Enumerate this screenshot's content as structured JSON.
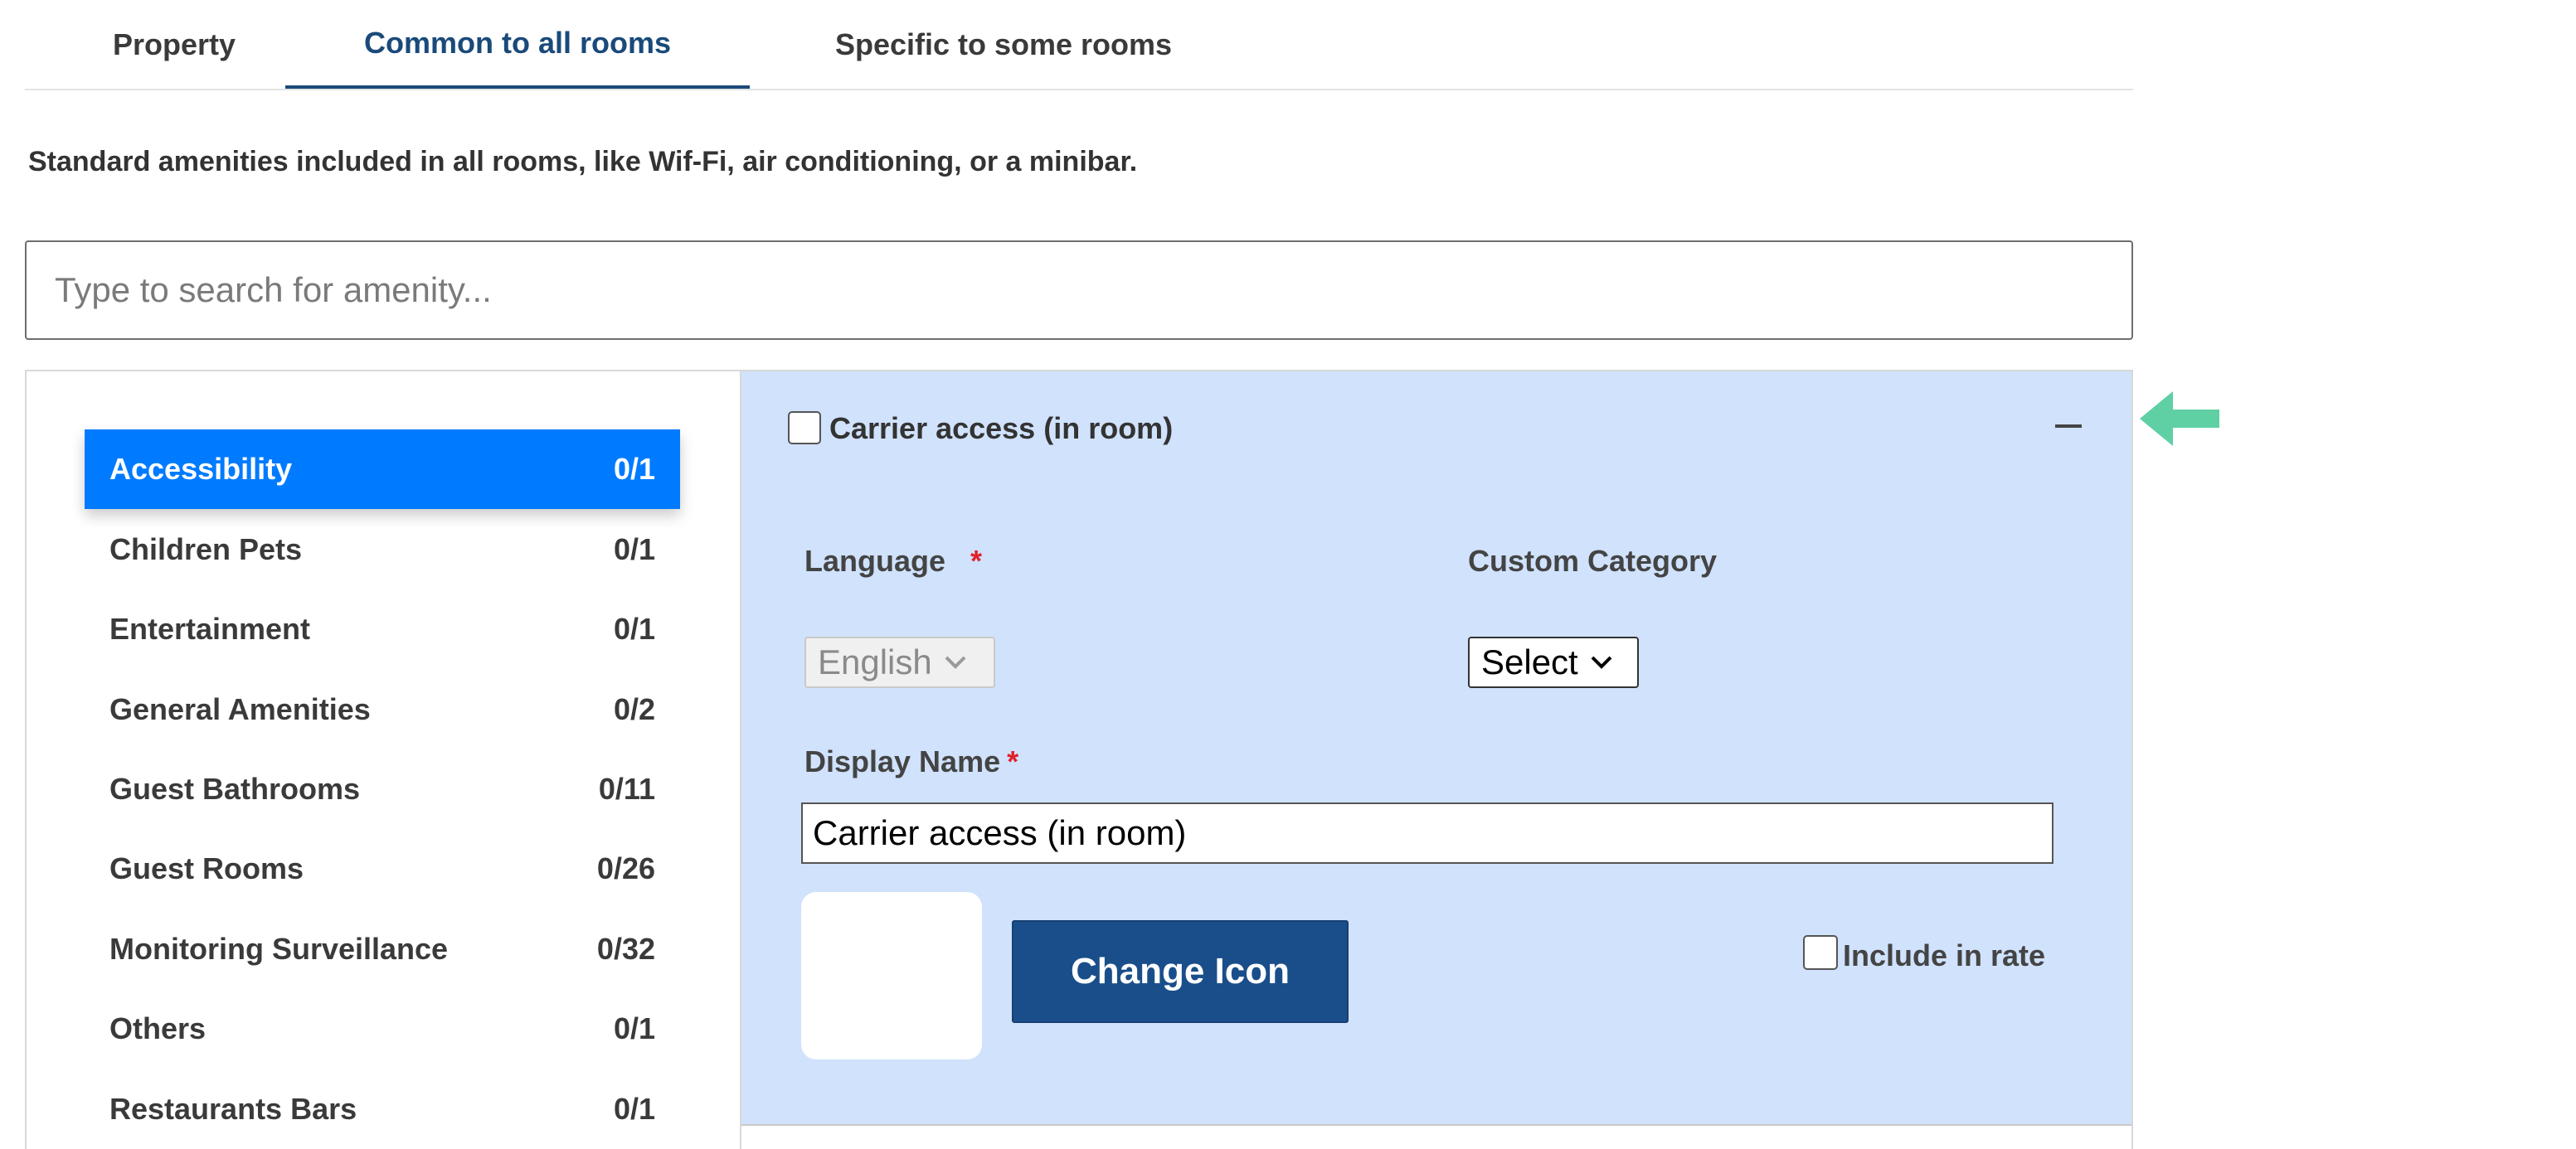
{
  "tabs": [
    {
      "label": "Property",
      "active": false
    },
    {
      "label": "Common to all rooms",
      "active": true
    },
    {
      "label": "Specific to some rooms",
      "active": false
    }
  ],
  "description": "Standard amenities included in all rooms, like Wif-Fi, air conditioning, or a minibar.",
  "search": {
    "placeholder": "Type to search for amenity...",
    "value": ""
  },
  "categories": [
    {
      "label": "Accessibility",
      "count": "0/1",
      "active": true
    },
    {
      "label": "Children Pets",
      "count": "0/1"
    },
    {
      "label": "Entertainment",
      "count": "0/1"
    },
    {
      "label": "General Amenities",
      "count": "0/2"
    },
    {
      "label": "Guest Bathrooms",
      "count": "0/11"
    },
    {
      "label": "Guest Rooms",
      "count": "0/26"
    },
    {
      "label": "Monitoring Surveillance",
      "count": "0/32"
    },
    {
      "label": "Others",
      "count": "0/1"
    },
    {
      "label": "Restaurants Bars",
      "count": "0/1"
    }
  ],
  "amenity": {
    "title": "Carrier access (in room)",
    "checked": false,
    "language_label": "Language",
    "required_mark": "*",
    "language_value": "English",
    "custom_category_label": "Custom Category",
    "custom_category_value": "Select",
    "display_name_label": "Display Name",
    "display_name_value": "Carrier access (in room)",
    "change_icon_label": "Change Icon",
    "include_in_rate_label": "Include in rate",
    "include_in_rate_checked": false
  },
  "colors": {
    "accent": "#007bff",
    "panel_bg": "#d0e2fc",
    "button": "#1a4e8a",
    "arrow": "#5fd0a4",
    "active_tab": "#1a4a7a"
  },
  "icons": {
    "collapse": "minus-icon",
    "pointer": "arrow-left-icon",
    "dropdown": "chevron-down-icon"
  }
}
